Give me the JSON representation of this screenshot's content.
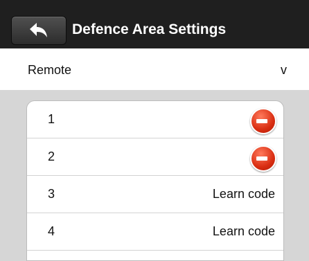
{
  "header": {
    "title": "Defence Area Settings",
    "back_icon": "back-arrow-icon"
  },
  "selector": {
    "label": "Remote",
    "value": "v"
  },
  "rows": [
    {
      "number": "1",
      "action": "delete",
      "icon": "delete-icon"
    },
    {
      "number": "2",
      "action": "delete",
      "icon": "delete-icon"
    },
    {
      "number": "3",
      "action": "Learn code"
    },
    {
      "number": "4",
      "action": "Learn code"
    }
  ],
  "colors": {
    "header_bg": "#1f1f1f",
    "page_bg": "#d6d6d6",
    "delete_red": "#d92e12"
  }
}
